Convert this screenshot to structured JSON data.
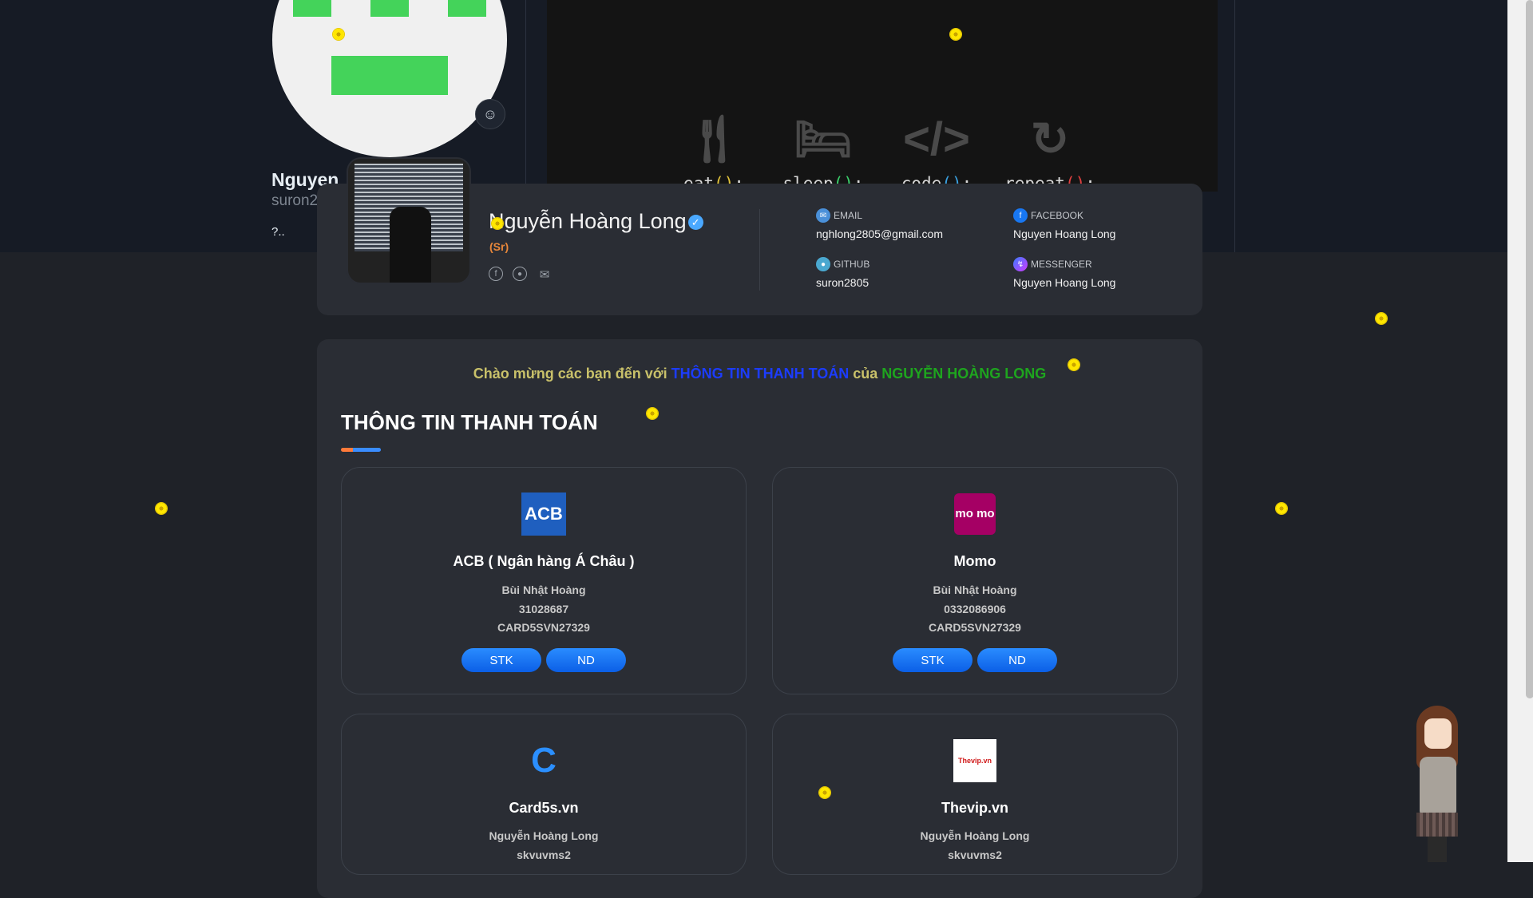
{
  "github_profile": {
    "name": "Nguyen",
    "username": "suron2",
    "bio": "?..",
    "emoji_icon": "smiley-icon"
  },
  "banner": {
    "items": [
      {
        "icon": "fork-knife-icon",
        "label_prefix": "eat",
        "label_suffix": ";",
        "paren_color": "#e0c23a"
      },
      {
        "icon": "bed-icon",
        "label_prefix": "sleep",
        "label_suffix": ";",
        "paren_color": "#3ad06a"
      },
      {
        "icon": "code-icon",
        "label_prefix": "code",
        "label_suffix": ";",
        "paren_color": "#3aa0e0"
      },
      {
        "icon": "repeat-icon",
        "label_prefix": "repeat",
        "label_suffix": ";",
        "paren_color": "#e04040"
      }
    ],
    "parens": "()"
  },
  "profile": {
    "name": "Nguyễn Hoàng Long",
    "rank": "(Sr)",
    "socials": [
      "facebook-icon",
      "github-icon",
      "email-icon"
    ],
    "contacts": {
      "email": {
        "label": "EMAIL",
        "value": "nghlong2805@gmail.com"
      },
      "facebook": {
        "label": "FACEBOOK",
        "value": "Nguyen Hoang Long"
      },
      "github": {
        "label": "GITHUB",
        "value": "suron2805"
      },
      "messenger": {
        "label": "MESSENGER",
        "value": "Nguyen Hoang Long"
      }
    }
  },
  "payment": {
    "welcome": {
      "part1": "Chào mừng các bạn đến với ",
      "part2": "THÔNG TIN THANH TOÁN",
      "part3": " của ",
      "part4": "NGUYỄN HOÀNG LONG"
    },
    "title": "THÔNG TIN THANH TOÁN",
    "cards": [
      {
        "name": "ACB ( Ngân hàng Á Châu )",
        "logo_text": "ACB",
        "owner": "Bùi Nhật Hoàng",
        "number": "31028687",
        "content": "CARD5SVN27329",
        "btn1": "STK",
        "btn2": "ND"
      },
      {
        "name": "Momo",
        "logo_text": "mo mo",
        "owner": "Bùi Nhật Hoàng",
        "number": "0332086906",
        "content": "CARD5SVN27329",
        "btn1": "STK",
        "btn2": "ND"
      },
      {
        "name": "Card5s.vn",
        "logo_text": "C",
        "owner": "Nguyễn Hoàng Long",
        "number": "skvuvms2"
      },
      {
        "name": "Thevip.vn",
        "logo_text": "Thevip.vn",
        "owner": "Nguyễn Hoàng Long",
        "number": "skvuvms2"
      }
    ]
  },
  "colors": {
    "page_bg": "#1f2228",
    "card_bg": "#2a2d34",
    "button_blue": "#1a75ff",
    "welcome_yellow": "#c9c16a",
    "welcome_blue": "#1c3cff",
    "welcome_green": "#1ea51e"
  }
}
